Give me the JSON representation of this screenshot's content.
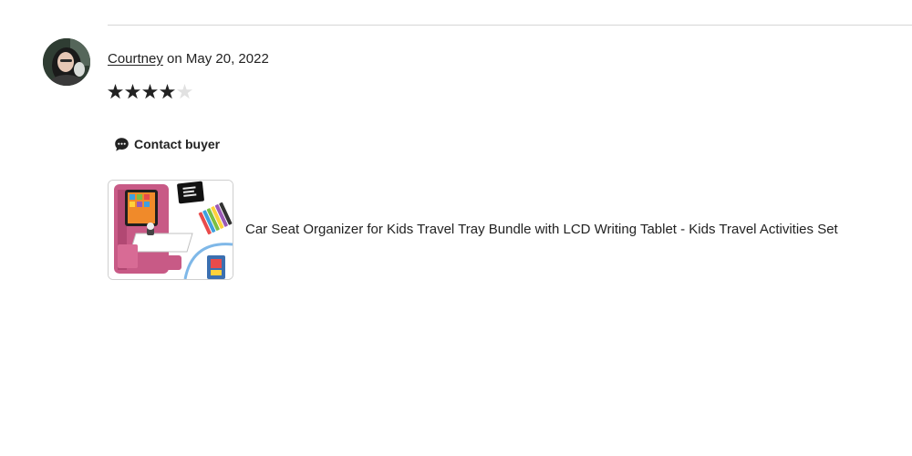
{
  "review": {
    "reviewer_name": "Courtney",
    "date_text": "on May 20, 2022",
    "rating": 4,
    "rating_max": 5,
    "colors": {
      "star_filled": "#222222",
      "star_empty": "#e1e1e1"
    }
  },
  "actions": {
    "contact_buyer_label": "Contact buyer",
    "contact_icon": "chat-bubble-icon"
  },
  "product": {
    "title": "Car Seat Organizer for Kids Travel Tray Bundle with LCD Writing Tablet - Kids Travel Activities Set",
    "image_alt": "Car seat organizer with tablet holder, LCD writing tablet and markers"
  }
}
